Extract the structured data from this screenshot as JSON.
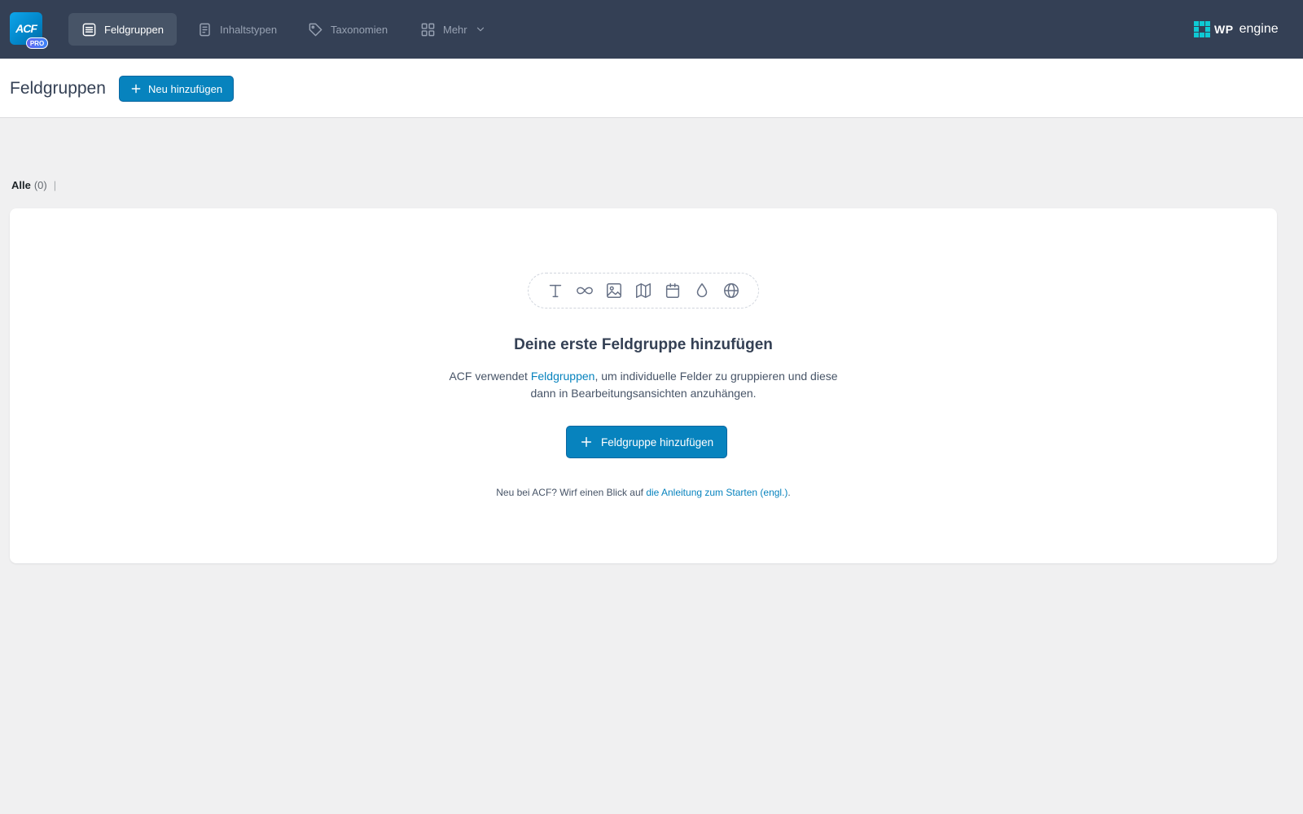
{
  "logo": {
    "text": "ACF",
    "badge": "PRO"
  },
  "nav": {
    "items": [
      {
        "label": "Feldgruppen",
        "icon": "list-icon",
        "active": true
      },
      {
        "label": "Inhaltstypen",
        "icon": "document-icon",
        "active": false
      },
      {
        "label": "Taxonomien",
        "icon": "tag-icon",
        "active": false
      },
      {
        "label": "Mehr",
        "icon": "grid-icon",
        "active": false
      }
    ]
  },
  "brand": {
    "wp": "WP",
    "engine": "engine",
    "accent": "#0ecad4"
  },
  "header": {
    "title": "Feldgruppen",
    "add_new": "Neu hinzufügen"
  },
  "filter": {
    "all_label": "Alle",
    "all_count": "(0)",
    "separator": "|"
  },
  "empty_state": {
    "icons": [
      "text-icon",
      "link-icon",
      "image-icon",
      "map-icon",
      "calendar-icon",
      "color-drop-icon",
      "globe-icon"
    ],
    "title": "Deine erste Feldgruppe hinzufügen",
    "desc_prefix": "ACF verwendet ",
    "desc_link": "Feldgruppen",
    "desc_suffix": ", um individuelle Felder zu gruppieren und diese dann in Bearbeitungsansichten anzuhängen.",
    "button": "Feldgruppe hinzufügen",
    "tip_prefix": "Neu bei ACF? Wirf einen Blick auf ",
    "tip_link": "die Anleitung zum Starten (engl.)",
    "tip_suffix": "."
  },
  "colors": {
    "topbar": "#344055",
    "primary": "#0783be",
    "background": "#f0f0f1"
  }
}
